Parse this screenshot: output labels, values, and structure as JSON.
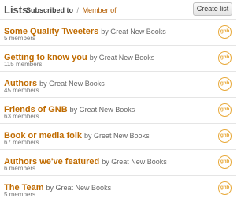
{
  "header": {
    "title": "Lists",
    "tab_active": "Subscribed to",
    "tab_separator": "/",
    "tab_other": "Member of",
    "create_label": "Create list"
  },
  "icon_text": "gnb",
  "lists": [
    {
      "name": "Some Quality Tweeters",
      "by": "by Great New Books",
      "members": "5 members"
    },
    {
      "name": "Getting to know you",
      "by": "by Great New Books",
      "members": "115 members"
    },
    {
      "name": "Authors",
      "by": "by Great New Books",
      "members": "45 members"
    },
    {
      "name": "Friends of GNB",
      "by": "by Great New Books",
      "members": "63 members"
    },
    {
      "name": "Book or media folk",
      "by": "by Great New Books",
      "members": "67 members"
    },
    {
      "name": "Authors we've featured",
      "by": "by Great New Books",
      "members": "6 members"
    },
    {
      "name": "The Team",
      "by": "by Great New Books",
      "members": "5 members"
    }
  ],
  "colors": {
    "accent": "#c06b00",
    "icon": "#e8a93a"
  }
}
